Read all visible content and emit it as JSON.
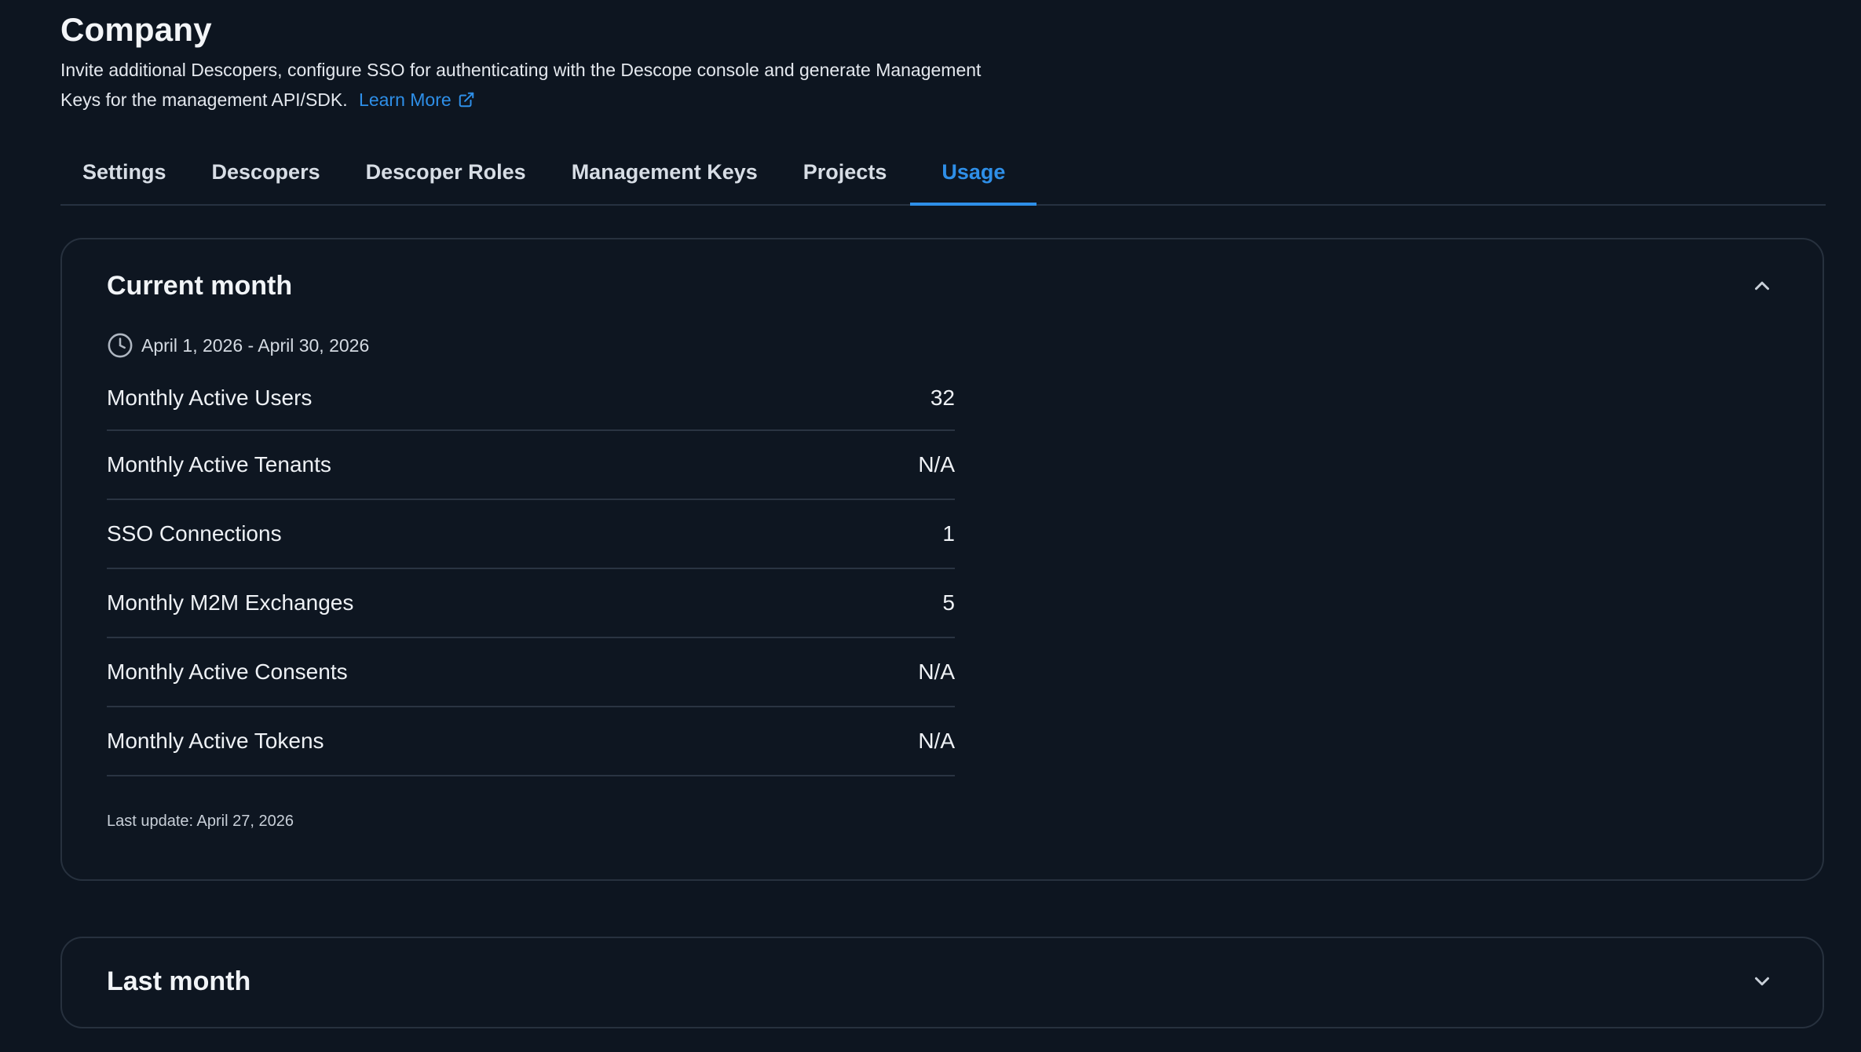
{
  "header": {
    "title": "Company",
    "description": "Invite additional Descopers, configure SSO for authenticating with the Descope console and generate Management Keys for the management API/SDK.",
    "learn_more": "Learn More"
  },
  "tabs": [
    {
      "label": "Settings",
      "active": false
    },
    {
      "label": "Descopers",
      "active": false
    },
    {
      "label": "Descoper Roles",
      "active": false
    },
    {
      "label": "Management Keys",
      "active": false
    },
    {
      "label": "Projects",
      "active": false
    },
    {
      "label": "Usage",
      "active": true
    }
  ],
  "current_month": {
    "title": "Current month",
    "date_range": "April 1, 2026 - April 30, 2026",
    "metrics": [
      {
        "label": "Monthly Active Users",
        "value": "32"
      },
      {
        "label": "Monthly Active Tenants",
        "value": "N/A"
      },
      {
        "label": "SSO Connections",
        "value": "1"
      },
      {
        "label": "Monthly M2M Exchanges",
        "value": "5"
      },
      {
        "label": "Monthly Active Consents",
        "value": "N/A"
      },
      {
        "label": "Monthly Active Tokens",
        "value": "N/A"
      }
    ],
    "last_update": "Last update: April 27, 2026",
    "expanded": true
  },
  "last_month": {
    "title": "Last month",
    "expanded": false
  },
  "colors": {
    "background": "#0d1520",
    "accent": "#2e8fe8",
    "border": "#27313e"
  }
}
